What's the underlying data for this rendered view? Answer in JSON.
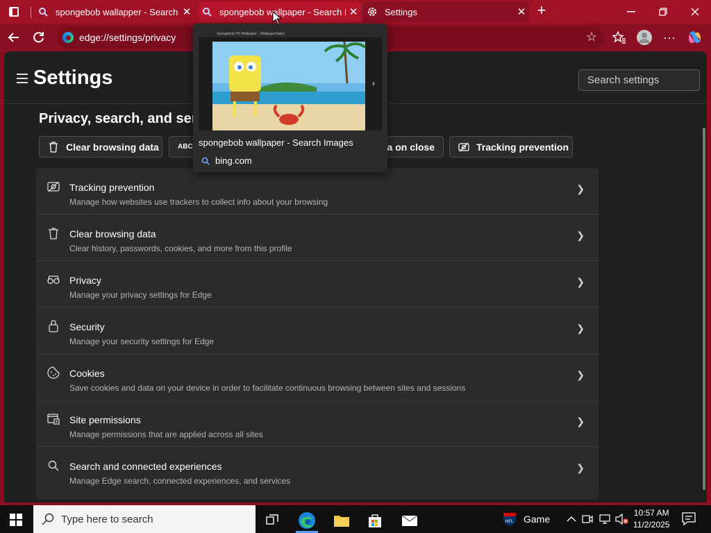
{
  "browser": {
    "tabs": [
      {
        "label": "spongebob wallapper - Search"
      },
      {
        "label": "spongebob wallpaper - Search Images"
      },
      {
        "label": "Settings"
      }
    ],
    "address": "edge://settings/privacy"
  },
  "preview": {
    "title": "spongebob wallpaper - Search Images",
    "domain": "bing.com",
    "thumb_caption": "Spongebob HD Wallpaper - WallpaperSafari"
  },
  "settings": {
    "title": "Settings",
    "search_placeholder": "Search settings",
    "section_title": "Privacy, search, and services",
    "quick_buttons": [
      {
        "label": "Clear browsing data"
      },
      {
        "label": "ABC"
      },
      {
        "label": "Clear browsing data on close"
      },
      {
        "label": "Tracking prevention"
      }
    ],
    "rows": [
      {
        "title": "Tracking prevention",
        "desc": "Manage how websites use trackers to collect info about your browsing",
        "icon": "tracking-icon"
      },
      {
        "title": "Clear browsing data",
        "desc": "Clear history, passwords, cookies, and more from this profile",
        "icon": "trash-icon"
      },
      {
        "title": "Privacy",
        "desc": "Manage your privacy settings for Edge",
        "icon": "glasses-icon"
      },
      {
        "title": "Security",
        "desc": "Manage your security settings for Edge",
        "icon": "lock-icon"
      },
      {
        "title": "Cookies",
        "desc": "Save cookies and data on your device in order to facilitate continuous browsing between sites and sessions",
        "icon": "cookie-icon"
      },
      {
        "title": "Site permissions",
        "desc": "Manage permissions that are applied across all sites",
        "icon": "permissions-icon"
      },
      {
        "title": "Search and connected experiences",
        "desc": "Manage Edge search, connected experiences, and services",
        "icon": "search-icon"
      }
    ]
  },
  "taskbar": {
    "search_placeholder": "Type here to search",
    "game_label": "Game",
    "time": "10:57 AM",
    "date": "11/2/2025"
  },
  "colors": {
    "frame": "#a11226",
    "toolbar": "#8b0f22",
    "page_bg": "#202020",
    "card_bg": "#2b2b2b"
  }
}
